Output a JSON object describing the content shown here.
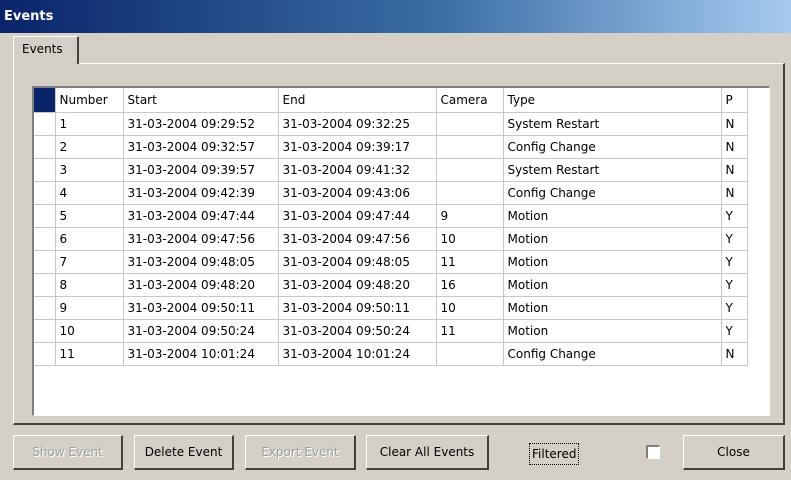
{
  "window": {
    "title": "Events"
  },
  "tabs": [
    {
      "label": "Events"
    }
  ],
  "table": {
    "columns": [
      "Number",
      "Start",
      "End",
      "Camera",
      "Type",
      "P"
    ],
    "rows": [
      [
        "1",
        "31-03-2004 09:29:52",
        "31-03-2004 09:32:25",
        "",
        "System Restart",
        "N"
      ],
      [
        "2",
        "31-03-2004 09:32:57",
        "31-03-2004 09:39:17",
        "",
        "Config Change",
        "N"
      ],
      [
        "3",
        "31-03-2004 09:39:57",
        "31-03-2004 09:41:32",
        "",
        "System Restart",
        "N"
      ],
      [
        "4",
        "31-03-2004 09:42:39",
        "31-03-2004 09:43:06",
        "",
        "Config Change",
        "N"
      ],
      [
        "5",
        "31-03-2004 09:47:44",
        "31-03-2004 09:47:44",
        "9",
        "Motion",
        "Y"
      ],
      [
        "6",
        "31-03-2004 09:47:56",
        "31-03-2004 09:47:56",
        "10",
        "Motion",
        "Y"
      ],
      [
        "7",
        "31-03-2004 09:48:05",
        "31-03-2004 09:48:05",
        "11",
        "Motion",
        "Y"
      ],
      [
        "8",
        "31-03-2004 09:48:20",
        "31-03-2004 09:48:20",
        "16",
        "Motion",
        "Y"
      ],
      [
        "9",
        "31-03-2004 09:50:11",
        "31-03-2004 09:50:11",
        "10",
        "Motion",
        "Y"
      ],
      [
        "10",
        "31-03-2004 09:50:24",
        "31-03-2004 09:50:24",
        "11",
        "Motion",
        "Y"
      ],
      [
        "11",
        "31-03-2004 10:01:24",
        "31-03-2004 10:01:24",
        "",
        "Config Change",
        "N"
      ]
    ]
  },
  "buttons": {
    "show_event": "Show Event",
    "delete_event": "Delete Event",
    "export_event": "Export Event",
    "clear_all_events": "Clear All Events",
    "close": "Close"
  },
  "filter": {
    "label": "Filtered",
    "checked": false
  },
  "colors": {
    "title_start": "#0a246a",
    "title_end": "#a6caf0",
    "selection": "#0a246a",
    "face": "#d4d0c8"
  }
}
